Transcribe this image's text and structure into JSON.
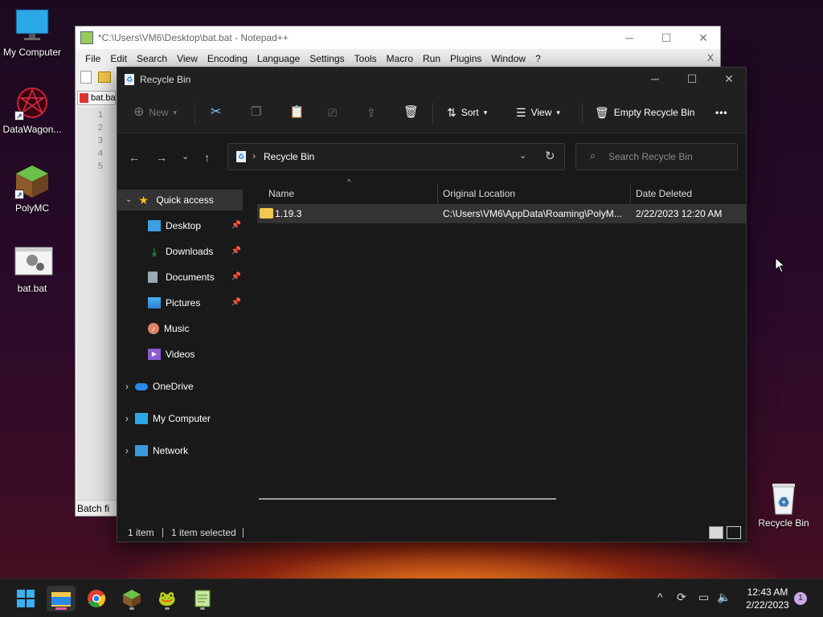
{
  "desktop": {
    "icons": [
      {
        "label": "My Computer"
      },
      {
        "label": "DataWagon..."
      },
      {
        "label": "PolyMC"
      },
      {
        "label": "bat.bat"
      },
      {
        "label": "Recycle Bin"
      }
    ]
  },
  "notepad": {
    "title": "*C:\\Users\\VM6\\Desktop\\bat.bat - Notepad++",
    "menu": [
      "File",
      "Edit",
      "Search",
      "View",
      "Encoding",
      "Language",
      "Settings",
      "Tools",
      "Macro",
      "Run",
      "Plugins",
      "Window",
      "?"
    ],
    "menu_close": "X",
    "tab": "bat.ba",
    "lines": [
      "1",
      "2",
      "3",
      "4",
      "5"
    ],
    "status": "Batch fi"
  },
  "explorer": {
    "title": "Recycle Bin",
    "cmd": {
      "new": "New",
      "sort": "Sort",
      "view": "View",
      "empty": "Empty Recycle Bin",
      "more": "•••"
    },
    "address": "Recycle Bin",
    "search_placeholder": "Search Recycle Bin",
    "sidebar": {
      "quick_access": "Quick access",
      "items": [
        {
          "label": "Desktop"
        },
        {
          "label": "Downloads"
        },
        {
          "label": "Documents"
        },
        {
          "label": "Pictures"
        },
        {
          "label": "Music"
        },
        {
          "label": "Videos"
        }
      ],
      "onedrive": "OneDrive",
      "mycomputer": "My Computer",
      "network": "Network"
    },
    "columns": {
      "name": "Name",
      "location": "Original Location",
      "date": "Date Deleted"
    },
    "rows": [
      {
        "name": "1.19.3",
        "location": "C:\\Users\\VM6\\AppData\\Roaming\\PolyM...",
        "date": "2/22/2023 12:20 AM"
      }
    ],
    "status": {
      "count": "1 item",
      "selected": "1 item selected"
    }
  },
  "taskbar": {
    "time": "12:43 AM",
    "date": "2/22/2023",
    "badge": "1"
  }
}
